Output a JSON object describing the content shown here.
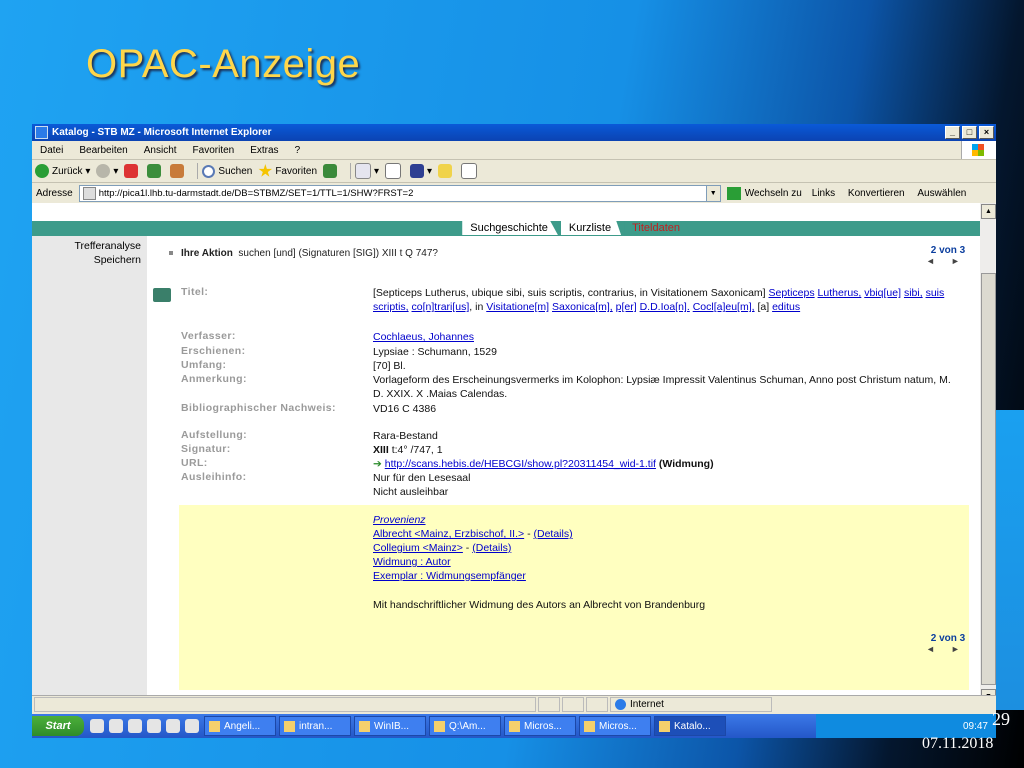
{
  "slide": {
    "title": "OPAC-Anzeige",
    "page_number": "29",
    "date": "07.11.2018"
  },
  "window": {
    "title": "Katalog - STB MZ - Microsoft Internet Explorer",
    "buttons": [
      "_",
      "□",
      "×"
    ]
  },
  "menu": [
    "Datei",
    "Bearbeiten",
    "Ansicht",
    "Favoriten",
    "Extras",
    "?"
  ],
  "toolbar": {
    "back": "Zurück",
    "search": "Suchen",
    "favorites": "Favoriten"
  },
  "addressbar": {
    "label": "Adresse",
    "url": "http://pica1l.lhb.tu-darmstadt.de/DB=STBMZ/SET=1/TTL=1/SHW?FRST=2",
    "go": "Wechseln zu",
    "links": "Links",
    "convert": "Konvertieren",
    "select": "Auswählen"
  },
  "sidebar": {
    "items": [
      "Trefferanalyse",
      "Speichern"
    ]
  },
  "tabs": [
    {
      "label": "Suchgeschichte",
      "active": false
    },
    {
      "label": "Kurzliste",
      "active": false
    },
    {
      "label": "Titeldaten",
      "active": true
    }
  ],
  "action": {
    "prefix": "Ihre Aktion",
    "text": "suchen [und] (Signaturen [SIG]) XIII t Q 747?"
  },
  "pager": {
    "label": "2 von 3",
    "prev": "◄",
    "next": "►"
  },
  "record": {
    "titel_label": "Titel:",
    "titel_text": "[Septiceps Lutherus, ubique sibi, suis scriptis, contrarius, in Visitationem Saxonicam]",
    "titel_links": [
      "Septiceps",
      "Lutherus,",
      "vbiq[ue]",
      "sibi,",
      "suis",
      "scriptis,",
      "co[n]trari[us]",
      "Visitatione[m]",
      "Saxonica[m],",
      "p[er]",
      "D.D.Ioa[n].",
      "Cocl[a]eu[m],",
      "editus"
    ],
    "titel_sep": [
      "in",
      "[a]"
    ],
    "verfasser_label": "Verfasser:",
    "verfasser": "Cochlaeus, Johannes",
    "erschienen_label": "Erschienen:",
    "erschienen": "Lypsiae : Schumann, 1529",
    "umfang_label": "Umfang:",
    "umfang": "[70] Bl.",
    "anmerkung_label": "Anmerkung:",
    "anmerkung": "Vorlageform des Erscheinungsvermerks im Kolophon: Lypsiæ Impressit Valentinus Schuman, Anno post Christum natum, M. D. XXIX. X .Maias Calendas.",
    "nachweis_label": "Bibliographischer Nachweis:",
    "nachweis": "VD16 C 4386",
    "aufstellung_label": "Aufstellung:",
    "aufstellung": "Rara-Bestand",
    "signatur_label": "Signatur:",
    "signatur_bold": "XIII",
    "signatur_rest": "t:4° /747, 1",
    "url_label": "URL:",
    "url": "http://scans.hebis.de/HEBCGI/show.pl?20311454_wid-1.tif",
    "url_suffix": "(Widmung)",
    "ausleih_label": "Ausleihinfo:",
    "ausleih_1": "Nur für den Lesesaal",
    "ausleih_2": "Nicht ausleihbar",
    "provenienz": "Provenienz",
    "prov_1": "Albrecht <Mainz, Erzbischof, II.>",
    "prov_2": "Collegium <Mainz>",
    "details": "(Details)",
    "prov_3": "Widmung : Autor",
    "prov_4": "Exemplar : Widmungsempfänger",
    "note": "Mit handschriftlicher Widmung des Autors an Albrecht von Brandenburg"
  },
  "statusbar": {
    "zone": "Internet"
  },
  "taskbar": {
    "start": "Start",
    "tasks": [
      "Angeli...",
      "intran...",
      "WinIB...",
      "Q:\\Am...",
      "Micros...",
      "Micros...",
      "Katalo..."
    ],
    "clock": "09:47"
  }
}
